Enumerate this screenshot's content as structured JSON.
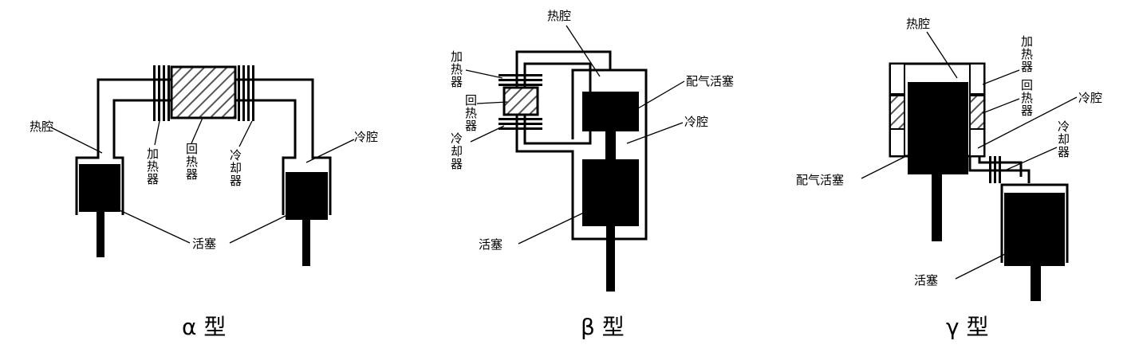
{
  "alpha": {
    "caption": "α 型",
    "hot_chamber": "热腔",
    "cold_chamber": "冷腔",
    "heater": [
      "加",
      "热",
      "器"
    ],
    "regenerator": [
      "回",
      "热",
      "器"
    ],
    "cooler": [
      "冷",
      "却",
      "器"
    ],
    "piston": "活塞"
  },
  "beta": {
    "caption": "β 型",
    "hot_chamber": "热腔",
    "heater": [
      "加",
      "热",
      "器"
    ],
    "regenerator": [
      "回",
      "热",
      "器"
    ],
    "cooler": [
      "冷",
      "却",
      "器"
    ],
    "displacer": "配气活塞",
    "cold_chamber": "冷腔",
    "piston": "活塞"
  },
  "gamma": {
    "caption": "γ 型",
    "hot_chamber": "热腔",
    "heater": [
      "加",
      "热",
      "器"
    ],
    "regenerator": [
      "回",
      "热",
      "器"
    ],
    "cold_chamber": "冷腔",
    "cooler": [
      "冷",
      "却",
      "器"
    ],
    "displacer": "配气活塞",
    "piston": "活塞"
  }
}
